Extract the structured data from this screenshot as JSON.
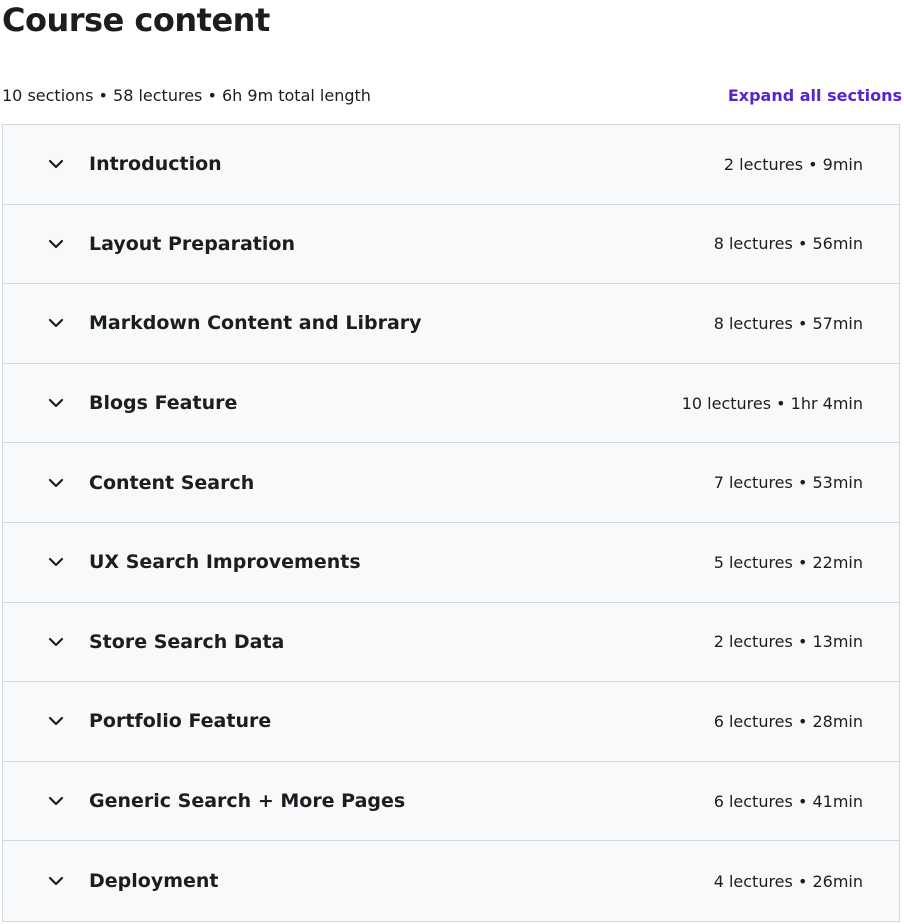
{
  "header": {
    "title": "Course content",
    "summary": "10 sections • 58 lectures • 6h 9m total length",
    "expand_all_label": "Expand all sections"
  },
  "icons": {
    "section_toggle": "chevron-down-icon"
  },
  "colors": {
    "accent": "#5624d0",
    "row_background": "#f7f9fa",
    "border": "#d1d7dc",
    "text": "#1c1d1f"
  },
  "sections": [
    {
      "title": "Introduction",
      "meta": "2 lectures • 9min"
    },
    {
      "title": "Layout Preparation",
      "meta": "8 lectures • 56min"
    },
    {
      "title": "Markdown Content and Library",
      "meta": "8 lectures • 57min"
    },
    {
      "title": "Blogs Feature",
      "meta": "10 lectures • 1hr 4min"
    },
    {
      "title": "Content Search",
      "meta": "7 lectures • 53min"
    },
    {
      "title": "UX Search Improvements",
      "meta": "5 lectures • 22min"
    },
    {
      "title": "Store Search Data",
      "meta": "2 lectures • 13min"
    },
    {
      "title": "Portfolio Feature",
      "meta": "6 lectures • 28min"
    },
    {
      "title": "Generic Search + More Pages",
      "meta": "6 lectures • 41min"
    },
    {
      "title": "Deployment",
      "meta": "4 lectures • 26min"
    }
  ]
}
